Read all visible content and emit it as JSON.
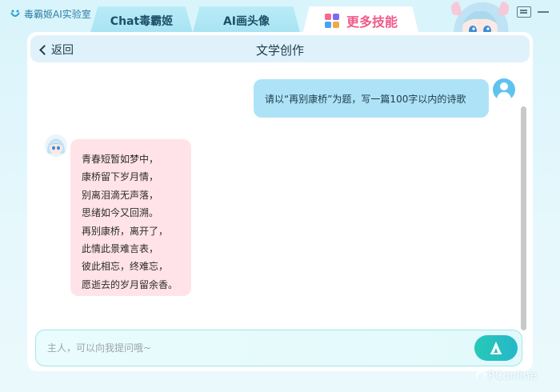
{
  "app": {
    "title": "毒霸姬AI实验室"
  },
  "tabs": [
    {
      "label": "Chat毒霸姬",
      "active": false
    },
    {
      "label": "AI画头像",
      "active": false
    },
    {
      "label": "更多技能",
      "active": true
    }
  ],
  "header": {
    "back_label": "返回",
    "title": "文学创作"
  },
  "chat": {
    "user_message": "请以“再别康桥”为题，写一篇100字以内的诗歌",
    "bot_lines": [
      "青春短暂如梦中，",
      "康桥留下岁月情，",
      "别离泪滴无声落，",
      "思绪如今又回溯。",
      "再别康桥，离开了，",
      "此情此景难言表，",
      "彼此相忘，终难忘，",
      "愿逝去的岁月留余香。"
    ]
  },
  "input": {
    "placeholder": "主人，可以向我提问哦~",
    "value": ""
  },
  "watermark": "PConline",
  "icons": {
    "app_logo": "app-logo-icon",
    "skills": "grid-icon",
    "messages": "message-icon",
    "minimize": "minimize-icon",
    "back": "chevron-left-icon",
    "send": "send-icon",
    "user_avatar": "user-avatar",
    "bot_avatar": "bot-avatar"
  },
  "colors": {
    "accent": "#2a7fa6",
    "active_tab_text": "#f05a8a",
    "user_bubble": "#aee3f7",
    "bot_bubble": "#ffe3e8",
    "send_button": "#27c9b7"
  }
}
